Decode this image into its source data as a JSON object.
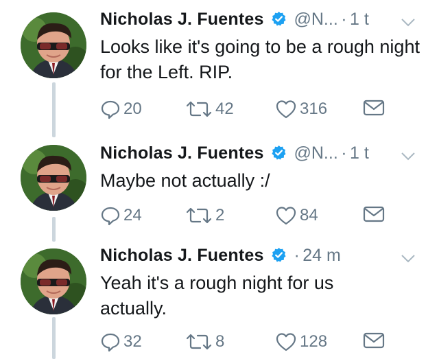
{
  "tweets": [
    {
      "name": "Nicholas J. Fuentes",
      "handle": "@N...",
      "dot": "·",
      "time": "1 t",
      "text": "Looks like it's going to be a rough night for the Left. RIP.",
      "replies": "20",
      "retweets": "42",
      "likes": "316"
    },
    {
      "name": "Nicholas J. Fuentes",
      "handle": "@N...",
      "dot": "·",
      "time": "1 t",
      "text": "Maybe not actually :/",
      "replies": "24",
      "retweets": "2",
      "likes": "84"
    },
    {
      "name": "Nicholas J. Fuentes",
      "handle": "",
      "dot": "·",
      "time": "24 m",
      "text": "Yeah it's a rough night for us actually.",
      "replies": "32",
      "retweets": "8",
      "likes": "128"
    }
  ],
  "colors": {
    "text": "#14171a",
    "secondary": "#657786",
    "verified": "#1da1f2",
    "thread_line": "#ccd6dd"
  },
  "icons": [
    "verified-badge-icon",
    "chevron-down-icon",
    "reply-icon",
    "retweet-icon",
    "like-icon",
    "message-icon"
  ]
}
